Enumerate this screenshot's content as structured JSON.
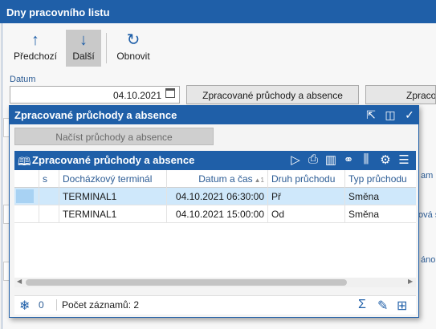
{
  "window": {
    "title": "Dny pracovního listu"
  },
  "toolbar": {
    "prev_label": "Předchozí",
    "next_label": "Další",
    "refresh_label": "Obnovit"
  },
  "form": {
    "datum_label": "Datum",
    "datum_value": "04.10.2021",
    "btn_processed": "Zpracované průchody a absence",
    "btn_partial": "Zpraco",
    "side_label_1": "am",
    "side_label_2": "ová sys",
    "side_label_3": "áno"
  },
  "dialog": {
    "title": "Zpracované průchody a absence",
    "load_button": "Načíst průchody a absence",
    "grid": {
      "title": "Zpracované průchody a absence",
      "columns": [
        "s",
        "Docházkový terminál",
        "Datum a čas",
        "Druh průchodu",
        "Typ průchodu"
      ],
      "sort_marker": "▲1",
      "rows": [
        {
          "s": "",
          "terminal": "TERMINAL1",
          "datetime": "04.10.2021 06:30:00",
          "druh": "Př",
          "typ": "Směna"
        },
        {
          "s": "",
          "terminal": "TERMINAL1",
          "datetime": "04.10.2021 15:00:00",
          "druh": "Od",
          "typ": "Směna"
        }
      ]
    },
    "status": {
      "filter_count": "0",
      "record_count": "Počet záznamů: 2"
    }
  },
  "colors": {
    "title_bar": "#1f5fa8",
    "selected_row": "#cfe8fb",
    "label_blue": "#2b5b94"
  }
}
